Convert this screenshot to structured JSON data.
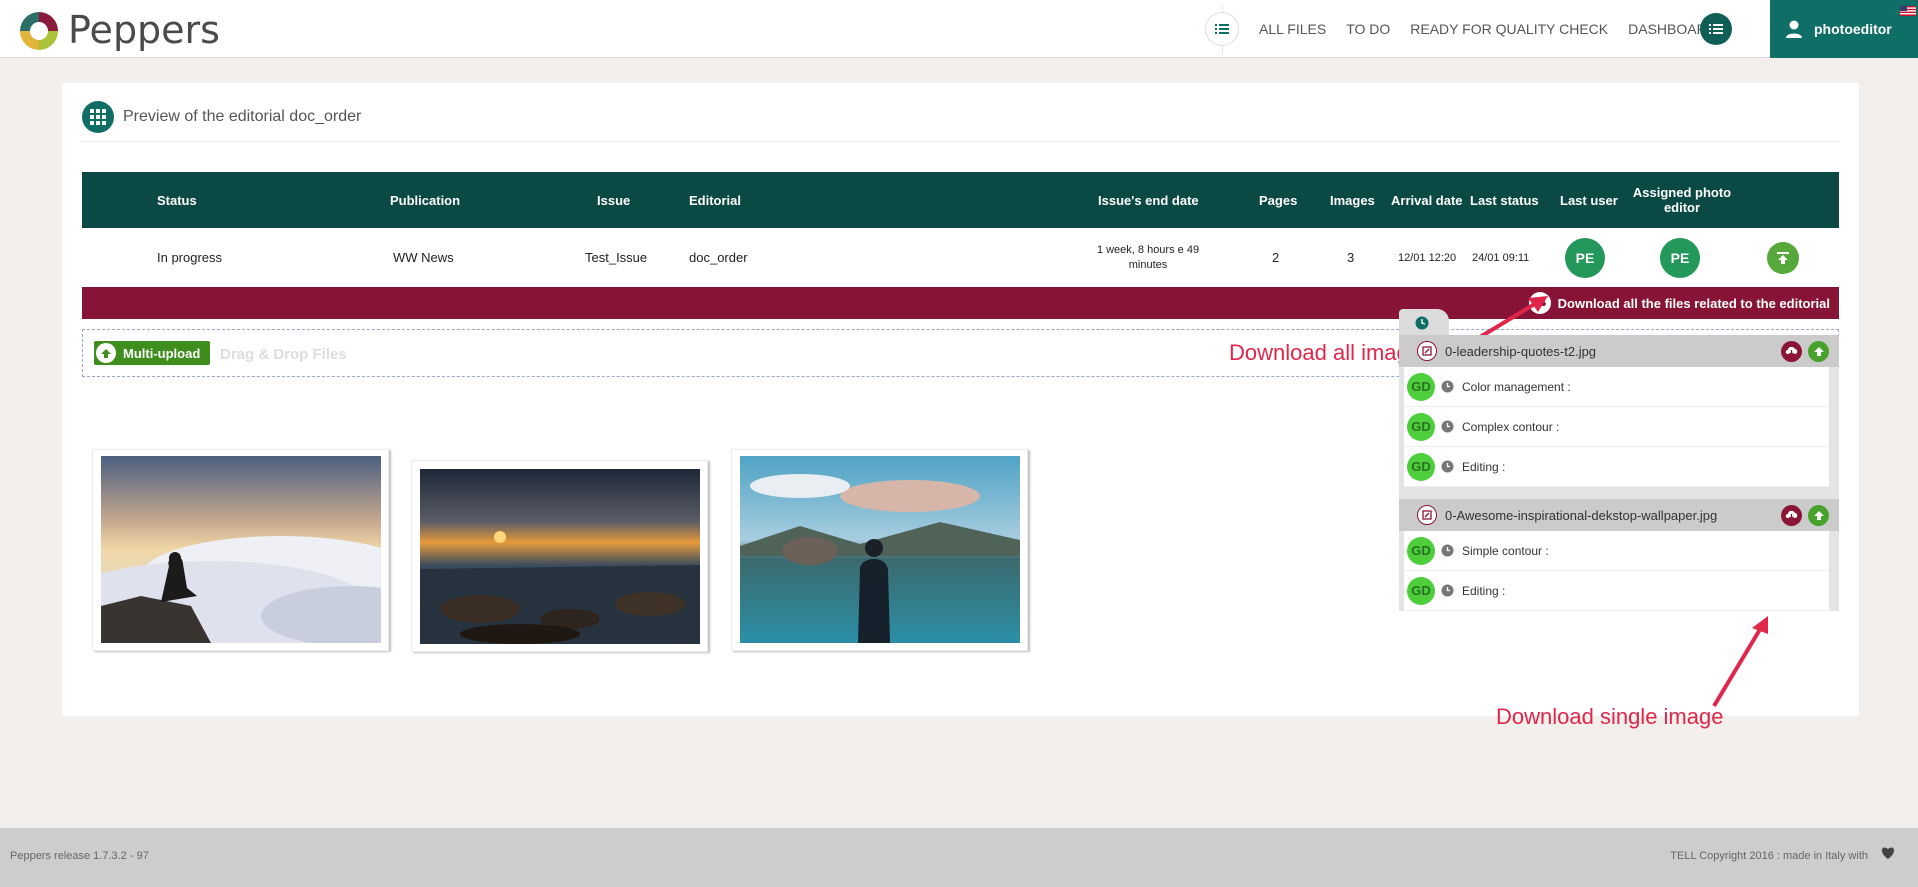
{
  "header": {
    "brand": "Peppers",
    "nav": [
      "ALL FILES",
      "TO DO",
      "READY FOR QUALITY CHECK",
      "DASHBOARD"
    ],
    "username": "photoeditor"
  },
  "panel": {
    "title": "Preview of the editorial doc_order"
  },
  "table": {
    "headers": {
      "status": "Status",
      "publication": "Publication",
      "issue": "Issue",
      "editorial": "Editorial",
      "end_date": "Issue's end date",
      "pages": "Pages",
      "images": "Images",
      "arrival": "Arrival date",
      "last_status": "Last status",
      "last_user": "Last user",
      "assigned": "Assigned photo editor"
    },
    "row": {
      "status": "In progress",
      "publication": "WW News",
      "issue": "Test_Issue",
      "editorial": "doc_order",
      "end_date": "1 week, 8 hours e 49 minutes",
      "pages": "2",
      "images": "3",
      "arrival": "12/01 12:20",
      "last_status": "24/01 09:11",
      "last_user": "PE",
      "assigned": "PE"
    }
  },
  "download_all_label": "Download all the files related to the editorial",
  "upload": {
    "button_label": "Multi-upload",
    "dropzone_text": "Drag & Drop Files"
  },
  "annotations": {
    "all": "Download all images",
    "single": "Download single image"
  },
  "files": [
    {
      "name": "0-leadership-quotes-t2.jpg",
      "tasks": [
        {
          "badge": "GD",
          "label": "Color management :"
        },
        {
          "badge": "GD",
          "label": "Complex contour :"
        },
        {
          "badge": "GD",
          "label": "Editing :"
        }
      ]
    },
    {
      "name": "0-Awesome-inspirational-dekstop-wallpaper.jpg",
      "tasks": [
        {
          "badge": "GD",
          "label": "Simple contour :"
        },
        {
          "badge": "GD",
          "label": "Editing :"
        }
      ]
    }
  ],
  "footer": {
    "release": "Peppers release 1.7.3.2 - 97",
    "copyright": "TELL Copyright 2016 : made in Italy with"
  },
  "colors": {
    "teal_dark": "#0b4a44",
    "teal": "#0f6e66",
    "bordeaux": "#871336",
    "green": "#3f8d1d",
    "badge_green": "#4ccf3b",
    "annotation_red": "#e0264a"
  }
}
